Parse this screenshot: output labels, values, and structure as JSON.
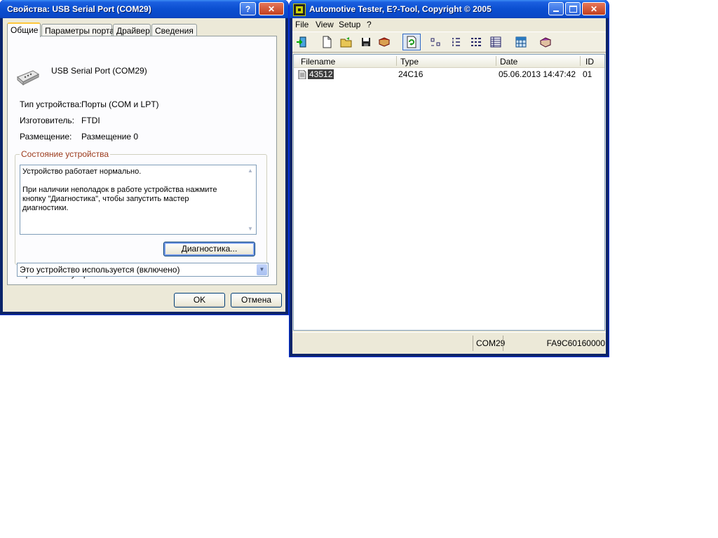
{
  "left_window": {
    "title": "Свойства: USB Serial Port (COM29)",
    "help_btn": "?",
    "close_btn": "✕",
    "tabs": [
      {
        "label": "Общие"
      },
      {
        "label": "Параметры порта"
      },
      {
        "label": "Драйвер"
      },
      {
        "label": "Сведения"
      }
    ],
    "device_name": "USB Serial Port (COM29)",
    "props": [
      {
        "label": "Тип устройства:",
        "value": "Порты (COM и LPT)"
      },
      {
        "label": "Изготовитель:",
        "value": "FTDI"
      },
      {
        "label": "Размещение:",
        "value": "Размещение 0"
      }
    ],
    "status_group_title": "Состояние устройства",
    "status_line1": "Устройство работает нормально.",
    "status_line2": "При наличии неполадок в работе устройства нажмите кнопку \"Диагностика\", чтобы запустить мастер диагностики.",
    "diagnostics_button": "Диагностика...",
    "usage_label": "Применение устройства:",
    "usage_value": "Это устройство используется (включено)",
    "ok_button": "OK",
    "cancel_button": "Отмена"
  },
  "right_window": {
    "title": "Automotive Tester, E?-Tool,  Copyright © 2005",
    "menu": [
      {
        "label": "File"
      },
      {
        "label": "View"
      },
      {
        "label": "Setup"
      },
      {
        "label": "?"
      }
    ],
    "toolbar_icons": [
      "export-icon",
      "new-file-icon",
      "open-folder-icon",
      "save-icon",
      "book-icon",
      "refresh-icon",
      "large-icons-icon",
      "small-icons-icon",
      "list-view-icon",
      "details-view-icon",
      "grid-icon",
      "help-book-icon"
    ],
    "columns": [
      "Filename",
      "Type",
      "Date",
      "ID"
    ],
    "rows": [
      {
        "filename": "43512",
        "type": "24C16",
        "date": "05.06.2013 14:47:42",
        "id": "01"
      }
    ],
    "status_port": "COM29",
    "status_serial": "FA9C60160000"
  }
}
